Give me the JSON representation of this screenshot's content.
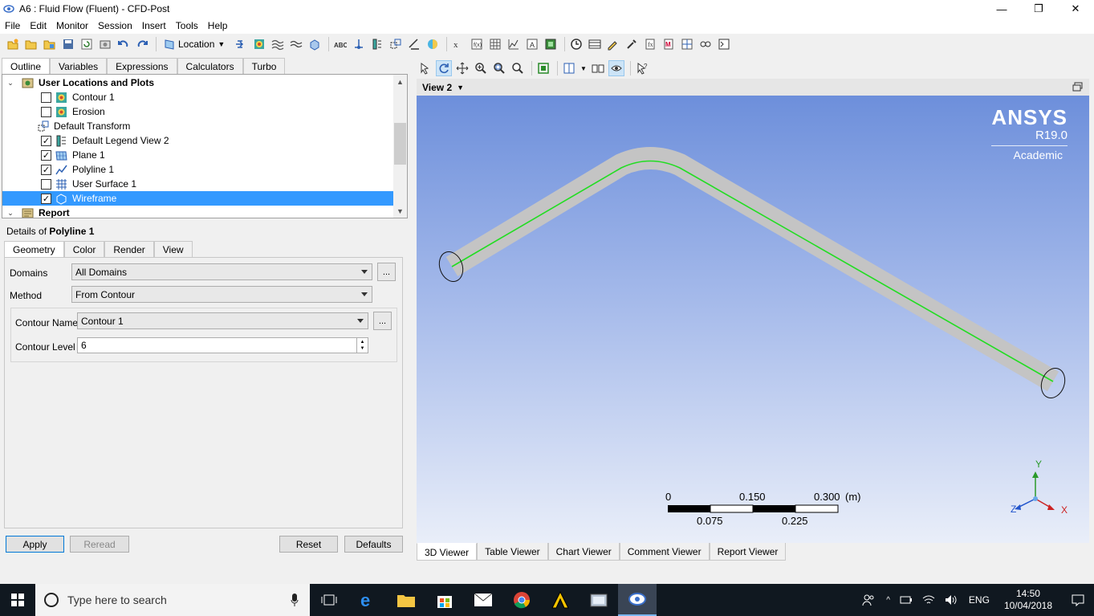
{
  "window": {
    "title": "A6 : Fluid Flow (Fluent) - CFD-Post",
    "minimize": "—",
    "maximize": "❐",
    "close": "✕"
  },
  "menu": [
    "File",
    "Edit",
    "Monitor",
    "Session",
    "Insert",
    "Tools",
    "Help"
  ],
  "toolbar": {
    "location_label": "Location"
  },
  "left_tabs": [
    "Outline",
    "Variables",
    "Expressions",
    "Calculators",
    "Turbo"
  ],
  "tree": {
    "root_label": "User Locations and Plots",
    "items": [
      {
        "label": "Contour 1",
        "checked": false
      },
      {
        "label": "Erosion",
        "checked": false
      },
      {
        "label": "Default Transform",
        "checked": null
      },
      {
        "label": "Default Legend View 2",
        "checked": true
      },
      {
        "label": "Plane 1",
        "checked": true
      },
      {
        "label": "Polyline 1",
        "checked": true
      },
      {
        "label": "User Surface 1",
        "checked": false
      },
      {
        "label": "Wireframe",
        "checked": true
      }
    ],
    "report_label": "Report"
  },
  "details": {
    "prefix": "Details of ",
    "object": "Polyline 1",
    "tabs": [
      "Geometry",
      "Color",
      "Render",
      "View"
    ],
    "domains_label": "Domains",
    "domains_value": "All Domains",
    "method_label": "Method",
    "method_value": "From Contour",
    "contour_name_label": "Contour Name",
    "contour_name_value": "Contour 1",
    "contour_level_label": "Contour Level",
    "contour_level_value": "6",
    "dots": "..."
  },
  "buttons": {
    "apply": "Apply",
    "reread": "Reread",
    "reset": "Reset",
    "defaults": "Defaults"
  },
  "viewer": {
    "view_name": "View 2",
    "brand": "ANSYS",
    "version": "R19.0",
    "edition": "Academic",
    "scale": {
      "t0": "0",
      "t150": "0.150",
      "t300": "0.300",
      "unit": "(m)",
      "t075": "0.075",
      "t225": "0.225"
    },
    "axes": {
      "x": "X",
      "y": "Y",
      "z": "Z"
    },
    "tabs": [
      "3D Viewer",
      "Table Viewer",
      "Chart Viewer",
      "Comment Viewer",
      "Report Viewer"
    ]
  },
  "taskbar": {
    "search_placeholder": "Type here to search",
    "lang": "ENG",
    "time": "14:50",
    "date": "10/04/2018"
  },
  "colors": {
    "selection": "#3399ff",
    "polyline": "#22dd22",
    "pipe": "#c4c4c4"
  }
}
